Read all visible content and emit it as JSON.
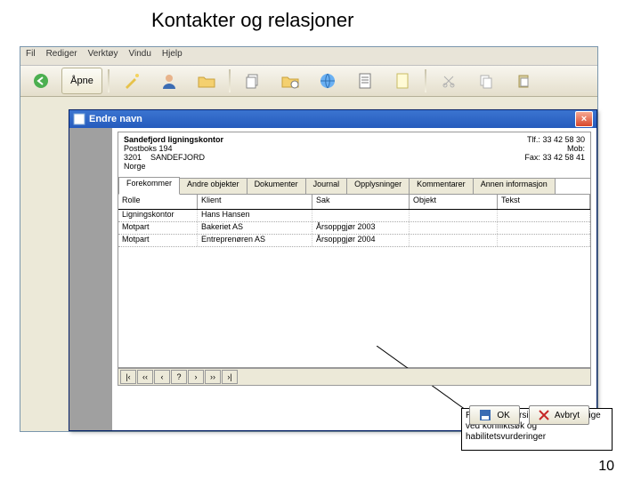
{
  "slide": {
    "title": "Kontakter og relasjoner",
    "page_number": "10"
  },
  "menu": {
    "items": [
      "Fil",
      "Rediger",
      "Verktøy",
      "Vindu",
      "Hjelp"
    ]
  },
  "toolbar": {
    "open_label": "Åpne"
  },
  "dialog": {
    "title": "Endre navn",
    "close": "×",
    "address": {
      "name": "Sandefjord ligningskontor",
      "pobox": "Postboks 194",
      "postcode": "3201",
      "city": "SANDEFJORD",
      "country": "Norge",
      "tlf_label": "Tlf.:",
      "tlf": "33 42 58 30",
      "mob_label": "Mob:",
      "mob": "",
      "fax_label": "Fax:",
      "fax": "33 42 58 41"
    },
    "tabs": [
      "Forekommer",
      "Andre objekter",
      "Dokumenter",
      "Journal",
      "Opplysninger",
      "Kommentarer",
      "Annen informasjon"
    ],
    "columns": [
      "Rolle",
      "Klient",
      "Sak",
      "Objekt",
      "Tekst"
    ],
    "rows": [
      {
        "rolle": "Ligningskontor",
        "klient": "Hans Hansen",
        "sak": "",
        "objekt": "",
        "tekst": ""
      },
      {
        "rolle": "Motpart",
        "klient": "Bakeriet AS",
        "sak": "Årsoppgjør 2003",
        "objekt": "",
        "tekst": ""
      },
      {
        "rolle": "Motpart",
        "klient": "Entreprenøren AS",
        "sak": "Årsoppgjør 2004",
        "objekt": "",
        "tekst": ""
      }
    ],
    "nav": [
      "|‹",
      "‹‹",
      "‹",
      "?",
      "›",
      "››",
      "›|"
    ],
    "ok": "OK",
    "cancel": "Avbryt"
  },
  "annotation": {
    "text": "Relasjonsoversikter som er viktige ved konfliktsøk og habilitetsvurderinger"
  }
}
